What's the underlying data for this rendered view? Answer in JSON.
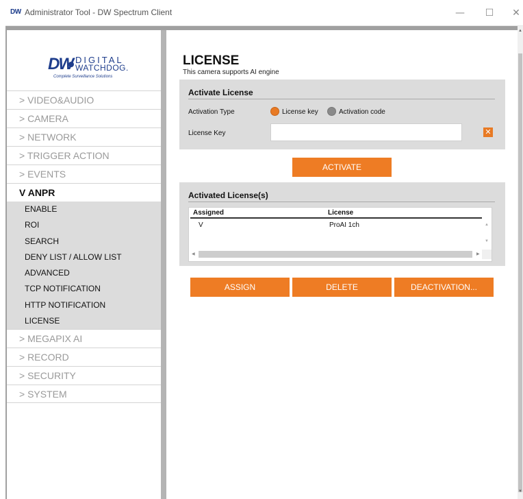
{
  "window": {
    "logo": "DW",
    "title": "Administrator Tool - DW Spectrum Client",
    "minimize": "—",
    "maximize": "☐",
    "close": "✕"
  },
  "brand": {
    "mark": "DW",
    "line1": "DIGITAL",
    "line2": "WATCHDOG.",
    "tagline": "Complete Surveillance Solutions"
  },
  "sidebar": {
    "items_before": [
      "> VIDEO&AUDIO",
      "> CAMERA",
      "> NETWORK",
      "> TRIGGER ACTION",
      "> EVENTS"
    ],
    "open_item": "V ANPR",
    "sub_items": [
      "ENABLE",
      "ROI",
      "SEARCH",
      "DENY LIST / ALLOW LIST",
      "ADVANCED",
      "TCP NOTIFICATION",
      "HTTP NOTIFICATION",
      "LICENSE"
    ],
    "items_after": [
      "> MEGAPIX AI",
      "> RECORD",
      "> SECURITY",
      "> SYSTEM"
    ]
  },
  "page": {
    "title": "LICENSE",
    "subtitle": "This camera supports AI engine"
  },
  "activate_panel": {
    "heading": "Activate License",
    "activation_type_label": "Activation Type",
    "option_license_key": "License key",
    "option_activation_code": "Activation code",
    "selected": "License key",
    "license_key_label": "License Key",
    "license_key_value": "",
    "clear_symbol": "✕"
  },
  "activate_button": "ACTIVATE",
  "activated_panel": {
    "heading": "Activated License(s)",
    "columns": [
      "Assigned",
      "License"
    ],
    "rows": [
      {
        "assigned": "V",
        "license": "ProAI 1ch"
      }
    ]
  },
  "actions": {
    "assign": "ASSIGN",
    "delete": "DELETE",
    "deactivation": "DEACTIVATION..."
  },
  "colors": {
    "accent": "#ee7c24",
    "brand": "#1e3d8c",
    "panel": "#dcdcdc",
    "submenu": "#dcdcdc"
  }
}
